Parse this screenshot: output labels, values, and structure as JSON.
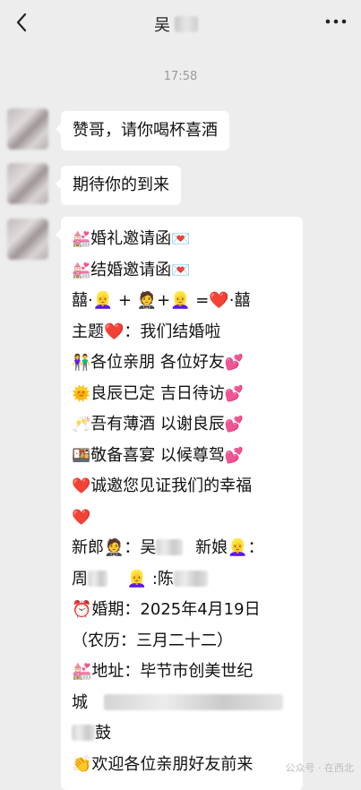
{
  "header": {
    "contact_name": "吴",
    "back_icon": "chevron-left-icon",
    "more_icon": "more-dots-icon"
  },
  "chat": {
    "timestamp": "17:58",
    "messages": [
      {
        "text": "赞哥，请你喝杯喜酒"
      },
      {
        "text": "期待你的到来"
      }
    ],
    "invitation": {
      "lines": [
        {
          "emoji": "💒",
          "text": "婚礼邀请函",
          "suffix": "💌"
        },
        {
          "emoji": "💒",
          "text": "结婚邀请函",
          "suffix": "💌"
        },
        {
          "emoji": "",
          "text": "囍·👱‍♀️ + 🤵+👱‍♀️ =❤️·囍",
          "suffix": ""
        },
        {
          "emoji": "",
          "text": "主题❤️：我们结婚啦",
          "suffix": ""
        },
        {
          "emoji": "👫",
          "text": "各位亲朋 各位好友",
          "suffix": "💕"
        },
        {
          "emoji": "🌞",
          "text": "良辰已定 吉日待访",
          "suffix": "💕"
        },
        {
          "emoji": "🥂",
          "text": "吾有薄酒 以谢良辰",
          "suffix": "💕"
        },
        {
          "emoji": "🍱",
          "text": "敬备喜宴 以候尊驾",
          "suffix": "💕"
        },
        {
          "emoji": "❤️",
          "text": "诚邀您见证我们的幸福",
          "suffix": ""
        },
        {
          "emoji": "❤️",
          "text": "",
          "suffix": ""
        }
      ],
      "groom_label": "新郎🤵：吴",
      "bride_label": "新娘👱‍♀️：",
      "line_zhou": "周",
      "line_chen_prefix": "👱‍♀️ :陈",
      "date_line": "⏰婚期：2025年4月19日",
      "lunar_line": "（农历：三月二十二）",
      "address_line": "💒地址：毕节市创美世纪",
      "city_prefix": "城",
      "last_word": "鼓",
      "welcome_line": "👏欢迎各位亲朋好友前来"
    }
  },
  "watermark": "公众号 · 在西北"
}
